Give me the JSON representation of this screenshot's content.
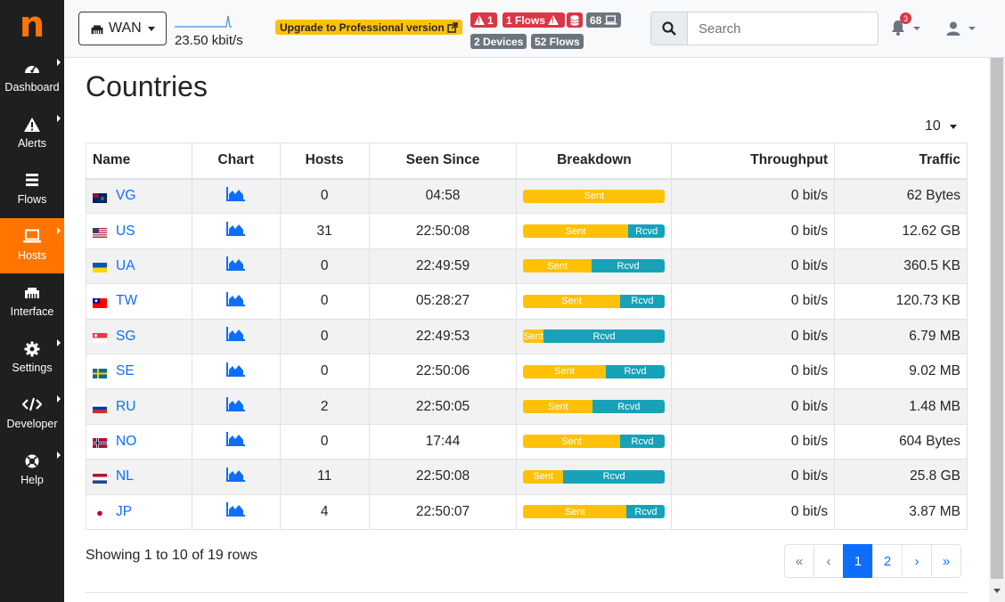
{
  "sidebar": {
    "logo": "n",
    "items": [
      {
        "label": "Dashboard",
        "icon": "gauge-icon",
        "active": false
      },
      {
        "label": "Alerts",
        "icon": "warning-icon",
        "active": false
      },
      {
        "label": "Flows",
        "icon": "stream-icon",
        "active": false
      },
      {
        "label": "Hosts",
        "icon": "laptop-icon",
        "active": true
      },
      {
        "label": "Interface",
        "icon": "ethernet-icon",
        "active": false
      },
      {
        "label": "Settings",
        "icon": "cog-icon",
        "active": false
      },
      {
        "label": "Developer",
        "icon": "code-icon",
        "active": false
      },
      {
        "label": "Help",
        "icon": "lifebuoy-icon",
        "active": false
      }
    ]
  },
  "header": {
    "interface": "WAN",
    "throughput": "23.50 kbit/s",
    "upgrade": "Upgrade to Professional version",
    "badges": {
      "alerts": "1",
      "flow_alerts": "1 Flows",
      "hosts": "68",
      "devices": "2 Devices",
      "flows": "52 Flows"
    },
    "search_placeholder": "Search",
    "notifications": "3"
  },
  "page": {
    "title": "Countries",
    "per_page": "10",
    "columns": [
      "Name",
      "Chart",
      "Hosts",
      "Seen Since",
      "Breakdown",
      "Throughput",
      "Traffic"
    ],
    "rows": [
      {
        "name": "VG",
        "hosts": "0",
        "seen": "04:58",
        "sent_pct": 100,
        "sent": "Sent",
        "rcvd": "",
        "throughput": "0 bit/s",
        "traffic": "62 Bytes"
      },
      {
        "name": "US",
        "hosts": "31",
        "seen": "22:50:08",
        "sent_pct": 74,
        "sent": "Sent",
        "rcvd": "Rcvd",
        "throughput": "0 bit/s",
        "traffic": "12.62 GB"
      },
      {
        "name": "UA",
        "hosts": "0",
        "seen": "22:49:59",
        "sent_pct": 48,
        "sent": "Sent",
        "rcvd": "Rcvd",
        "throughput": "0 bit/s",
        "traffic": "360.5 KB"
      },
      {
        "name": "TW",
        "hosts": "0",
        "seen": "05:28:27",
        "sent_pct": 68,
        "sent": "Sent",
        "rcvd": "Rcvd",
        "throughput": "0 bit/s",
        "traffic": "120.73 KB"
      },
      {
        "name": "SG",
        "hosts": "0",
        "seen": "22:49:53",
        "sent_pct": 14,
        "sent": "Sent",
        "rcvd": "Rcvd",
        "throughput": "0 bit/s",
        "traffic": "6.79 MB"
      },
      {
        "name": "SE",
        "hosts": "0",
        "seen": "22:50:06",
        "sent_pct": 58,
        "sent": "Sent",
        "rcvd": "Rcvd",
        "throughput": "0 bit/s",
        "traffic": "9.02 MB"
      },
      {
        "name": "RU",
        "hosts": "2",
        "seen": "22:50:05",
        "sent_pct": 49,
        "sent": "Sent",
        "rcvd": "Rcvd",
        "throughput": "0 bit/s",
        "traffic": "1.48 MB"
      },
      {
        "name": "NO",
        "hosts": "0",
        "seen": "17:44",
        "sent_pct": 68,
        "sent": "Sent",
        "rcvd": "Rcvd",
        "throughput": "0 bit/s",
        "traffic": "604 Bytes"
      },
      {
        "name": "NL",
        "hosts": "11",
        "seen": "22:50:08",
        "sent_pct": 28,
        "sent": "Sent",
        "rcvd": "Rcvd",
        "throughput": "0 bit/s",
        "traffic": "25.8 GB"
      },
      {
        "name": "JP",
        "hosts": "4",
        "seen": "22:50:07",
        "sent_pct": 73,
        "sent": "Sent",
        "rcvd": "Rcvd",
        "throughput": "0 bit/s",
        "traffic": "3.87 MB"
      }
    ],
    "showing": "Showing 1 to 10 of 19 rows",
    "pagination": [
      "«",
      "‹",
      "1",
      "2",
      "›",
      "»"
    ],
    "current_page": "1"
  },
  "colors": {
    "accent": "#ff7500",
    "sent": "#ffc107",
    "rcvd": "#17a2b8",
    "link": "#0d6efd"
  }
}
